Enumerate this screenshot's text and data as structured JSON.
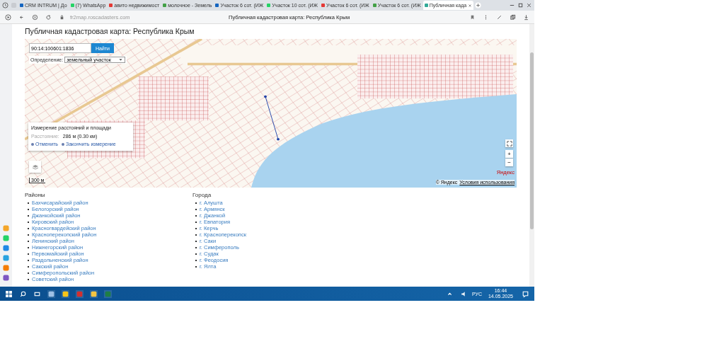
{
  "browser": {
    "tabs": [
      {
        "label": "CRM INTRUM | До",
        "selected": false
      },
      {
        "label": "(7) WhatsApp",
        "selected": false
      },
      {
        "label": "авито недвижимост",
        "selected": false
      },
      {
        "label": "молочное - Земель",
        "selected": false
      },
      {
        "label": "Участок 6 сот. (ИЖ",
        "selected": false
      },
      {
        "label": "Участок 10 сот. (ИЖ",
        "selected": false
      },
      {
        "label": "Участок 6 сот. (ИЖ",
        "selected": false
      },
      {
        "label": "Участок 6 сот. (ИЖ",
        "selected": false
      },
      {
        "label": "Публичная када",
        "selected": true
      }
    ],
    "address": "fr2map.roscadasters.com",
    "page_title": "Публичная кадастровая карта: Республика Крым"
  },
  "page": {
    "heading": "Публичная кадастровая карта: Республика Крым",
    "map": {
      "search": {
        "value": "90:14:100601:1836",
        "button": "Найти"
      },
      "mode": {
        "label": "Определение:",
        "value": "земельный участок"
      },
      "measure": {
        "title": "Измерение расстояний и площади",
        "label": "Расстояние:",
        "reading": "286 м (0.30 км)",
        "actions": [
          "Отменить",
          "Закончить измерение"
        ]
      },
      "zoom_in": "+",
      "zoom_out": "−",
      "scale": "300 м",
      "attribution": "© Яндекс",
      "terms": "Условия использования",
      "logo": "Яндекс"
    },
    "districts": {
      "heading": "Районы",
      "items": [
        "Бахчисарайский район",
        "Белогорский район",
        "Джанкойский район",
        "Кировский район",
        "Красногвардейский район",
        "Красноперекопский район",
        "Ленинский район",
        "Нижнегорский район",
        "Первомайский район",
        "Раздольненский район",
        "Сакский район",
        "Симферопольский район",
        "Советский район"
      ]
    },
    "cities": {
      "heading": "Города",
      "items": [
        "г. Алушта",
        "г. Армянск",
        "г. Джанкой",
        "г. Евпатория",
        "г. Керчь",
        "г. Красноперекопск",
        "г. Саки",
        "г. Симферополь",
        "г. Судак",
        "г. Феодосия",
        "г. Ялта"
      ]
    }
  },
  "taskbar": {
    "language": "РУС",
    "time": "16:44",
    "date": "14.05.2025"
  }
}
